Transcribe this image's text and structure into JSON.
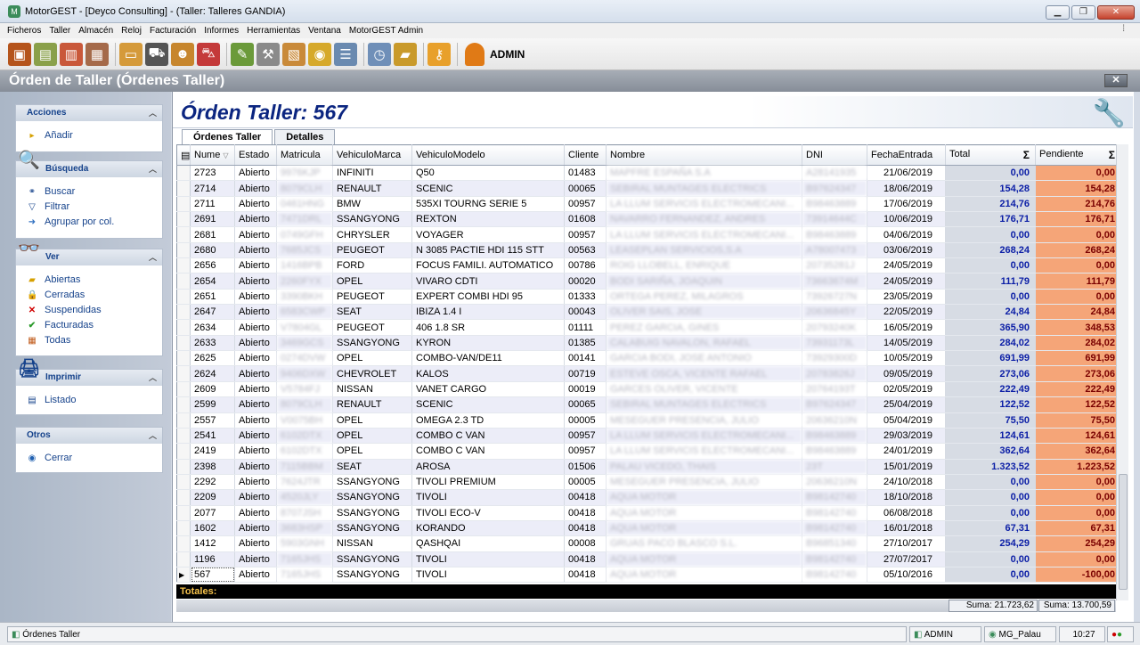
{
  "window": {
    "title": "MotorGEST - [Deyco Consulting] - (Taller: Talleres GANDIA)"
  },
  "menu": [
    "Ficheros",
    "Taller",
    "Almacén",
    "Reloj",
    "Facturación",
    "Informes",
    "Herramientas",
    "Ventana",
    "MotorGEST Admin"
  ],
  "toolbar": {
    "user": "ADMIN"
  },
  "form": {
    "title": "Órden de Taller (Órdenes Taller)",
    "header": "Órden Taller: 567",
    "close_glyph": "✕"
  },
  "tabs": [
    {
      "label": "Órdenes Taller"
    },
    {
      "label": "Detalles"
    }
  ],
  "sidebar": {
    "groups": [
      {
        "title": "Acciones",
        "items": [
          "Añadir"
        ]
      },
      {
        "title": "Búsqueda",
        "items": [
          "Buscar",
          "Filtrar",
          "Agrupar por col."
        ]
      },
      {
        "title": "Ver",
        "items": [
          "Abiertas",
          "Cerradas",
          "Suspendidas",
          "Facturadas",
          "Todas"
        ]
      },
      {
        "title": "Imprimir",
        "items": [
          "Listado"
        ]
      },
      {
        "title": "Otros",
        "items": [
          "Cerrar"
        ]
      }
    ]
  },
  "grid": {
    "columns": [
      "Nume",
      "Estado",
      "Matricula",
      "VehiculoMarca",
      "VehiculoModelo",
      "Cliente",
      "Nombre",
      "DNI",
      "FechaEntrada",
      "Total",
      "Pendiente"
    ],
    "sigma": "Σ",
    "rows": [
      [
        "2723",
        "Abierto",
        "9976KJP",
        "INFINITI",
        "Q50",
        "01483",
        "MAPFRE ESPAÑA S.A",
        "A28141935",
        "21/06/2019",
        "0,00",
        "0,00"
      ],
      [
        "2714",
        "Abierto",
        "8079CLH",
        "RENAULT",
        "SCENIC",
        "00065",
        "SEBIRAL MUNTAGES ELECTRICS",
        "B97624347",
        "18/06/2019",
        "154,28",
        "154,28"
      ],
      [
        "2711",
        "Abierto",
        "0461HNG",
        "BMW",
        "535XI TOURNG SERIE 5",
        "00957",
        "LA LLUM SERVICIS ELECTROMECANI...",
        "B98463889",
        "17/06/2019",
        "214,76",
        "214,76"
      ],
      [
        "2691",
        "Abierto",
        "7471DRL",
        "SSANGYONG",
        "REXTON",
        "01608",
        "NAVARRO FERNANDEZ, ANDRES",
        "73914644C",
        "10/06/2019",
        "176,71",
        "176,71"
      ],
      [
        "2681",
        "Abierto",
        "0749GFH",
        "CHRYSLER",
        "VOYAGER",
        "00957",
        "LA LLUM SERVICIS ELECTROMECANI...",
        "B98463889",
        "04/06/2019",
        "0,00",
        "0,00"
      ],
      [
        "2680",
        "Abierto",
        "7685JCS",
        "PEUGEOT",
        "N 3085 PACTIE HDI 115 STT",
        "00563",
        "LEASEPLAN SERVICIOS,S.A",
        "A78007473",
        "03/06/2019",
        "268,24",
        "268,24"
      ],
      [
        "2656",
        "Abierto",
        "1416BPB",
        "FORD",
        "FOCUS FAMILI. AUTOMATICO",
        "00786",
        "ROIG LLOBELL, ENRIQUE",
        "20735281J",
        "24/05/2019",
        "0,00",
        "0,00"
      ],
      [
        "2654",
        "Abierto",
        "2260FYX",
        "OPEL",
        "VIVARO CDTI",
        "00020",
        "BODI SARIÑA, JOAQUIN",
        "73663674M",
        "24/05/2019",
        "111,79",
        "111,79"
      ],
      [
        "2651",
        "Abierto",
        "3390BKH",
        "PEUGEOT",
        "EXPERT COMBI HDI 95",
        "01333",
        "ORTEGA PEREZ, MILAGROS",
        "73926727N",
        "23/05/2019",
        "0,00",
        "0,00"
      ],
      [
        "2647",
        "Abierto",
        "6583CWP",
        "SEAT",
        "IBIZA 1.4 I",
        "00043",
        "OLIVER SAIS, JOSE",
        "20636845Y",
        "22/05/2019",
        "24,84",
        "24,84"
      ],
      [
        "2634",
        "Abierto",
        "V7804GL",
        "PEUGEOT",
        "406 1.8 SR",
        "01111",
        "PEREZ GARCIA, GINES",
        "20793240K",
        "16/05/2019",
        "365,90",
        "348,53"
      ],
      [
        "2633",
        "Abierto",
        "3469GCS",
        "SSANGYONG",
        "KYRON",
        "01385",
        "CALABUIG NAVALON, RAFAEL",
        "73931173L",
        "14/05/2019",
        "284,02",
        "284,02"
      ],
      [
        "2625",
        "Abierto",
        "0274DVW",
        "OPEL",
        "COMBO-VAN/DE11",
        "00141",
        "GARCIA BODI, JOSE ANTONIO",
        "73929300D",
        "10/05/2019",
        "691,99",
        "691,99"
      ],
      [
        "2624",
        "Abierto",
        "9406DXW",
        "CHEVROLET",
        "KALOS",
        "00719",
        "ESTEVE OSCA, VICENTE RAFAEL",
        "20783826J",
        "09/05/2019",
        "273,06",
        "273,06"
      ],
      [
        "2609",
        "Abierto",
        "V5784FJ",
        "NISSAN",
        "VANET CARGO",
        "00019",
        "GARCES OLIVER, VICENTE",
        "20764193T",
        "02/05/2019",
        "222,49",
        "222,49"
      ],
      [
        "2599",
        "Abierto",
        "8079CLH",
        "RENAULT",
        "SCENIC",
        "00065",
        "SEBIRAL MUNTAGES ELECTRICS",
        "B97624347",
        "25/04/2019",
        "122,52",
        "122,52"
      ],
      [
        "2557",
        "Abierto",
        "V0075BH",
        "OPEL",
        "OMEGA 2.3 TD",
        "00005",
        "MESEGUER PRESENCIA, JULIO",
        "20636210N",
        "05/04/2019",
        "75,50",
        "75,50"
      ],
      [
        "2541",
        "Abierto",
        "6102DTX",
        "OPEL",
        "COMBO C VAN",
        "00957",
        "LA LLUM SERVICIS ELECTROMECANI...",
        "B98463889",
        "29/03/2019",
        "124,61",
        "124,61"
      ],
      [
        "2419",
        "Abierto",
        "6102DTX",
        "OPEL",
        "COMBO C VAN",
        "00957",
        "LA LLUM SERVICIS ELECTROMECANI...",
        "B98463889",
        "24/01/2019",
        "362,64",
        "362,64"
      ],
      [
        "2398",
        "Abierto",
        "7115BBM",
        "SEAT",
        "AROSA",
        "01506",
        "PALAU VICEDO, THAIS",
        "23T",
        "15/01/2019",
        "1.323,52",
        "1.223,52"
      ],
      [
        "2292",
        "Abierto",
        "7624JTR",
        "SSANGYONG",
        "TIVOLI PREMIUM",
        "00005",
        "MESEGUER PRESENCIA, JULIO",
        "20636210N",
        "24/10/2018",
        "0,00",
        "0,00"
      ],
      [
        "2209",
        "Abierto",
        "4520JLY",
        "SSANGYONG",
        "TIVOLI",
        "00418",
        "AQUA MOTOR",
        "B98142740",
        "18/10/2018",
        "0,00",
        "0,00"
      ],
      [
        "2077",
        "Abierto",
        "8707JSH",
        "SSANGYONG",
        "TIVOLI ECO-V",
        "00418",
        "AQUA MOTOR",
        "B98142740",
        "06/08/2018",
        "0,00",
        "0,00"
      ],
      [
        "1602",
        "Abierto",
        "3683HSP",
        "SSANGYONG",
        "KORANDO",
        "00418",
        "AQUA MOTOR",
        "B98142740",
        "16/01/2018",
        "67,31",
        "67,31"
      ],
      [
        "1412",
        "Abierto",
        "5903GNH",
        "NISSAN",
        "QASHQAI",
        "00008",
        "GRUAS PACO BLASCO S.L.",
        "B96851340",
        "27/10/2017",
        "254,29",
        "254,29"
      ],
      [
        "1196",
        "Abierto",
        "7165JHS",
        "SSANGYONG",
        "TIVOLI",
        "00418",
        "AQUA MOTOR",
        "B98142740",
        "27/07/2017",
        "0,00",
        "0,00"
      ],
      [
        "567",
        "Abierto",
        "7165JHS",
        "SSANGYONG",
        "TIVOLI",
        "00418",
        "AQUA MOTOR",
        "B98142740",
        "05/10/2016",
        "0,00",
        "-100,00"
      ]
    ],
    "totals_label": "Totales:",
    "sum_total": "Suma:  21.723,62",
    "sum_pending": "Suma:  13.700,59"
  },
  "statusbar": {
    "form": "Órdenes Taller",
    "user": "ADMIN",
    "db": "MG_Palau",
    "time": "10:27"
  },
  "colors": {
    "pending_bg": "#f5a578",
    "title_blue": "#0b2580",
    "totals_bar": "#000000"
  }
}
